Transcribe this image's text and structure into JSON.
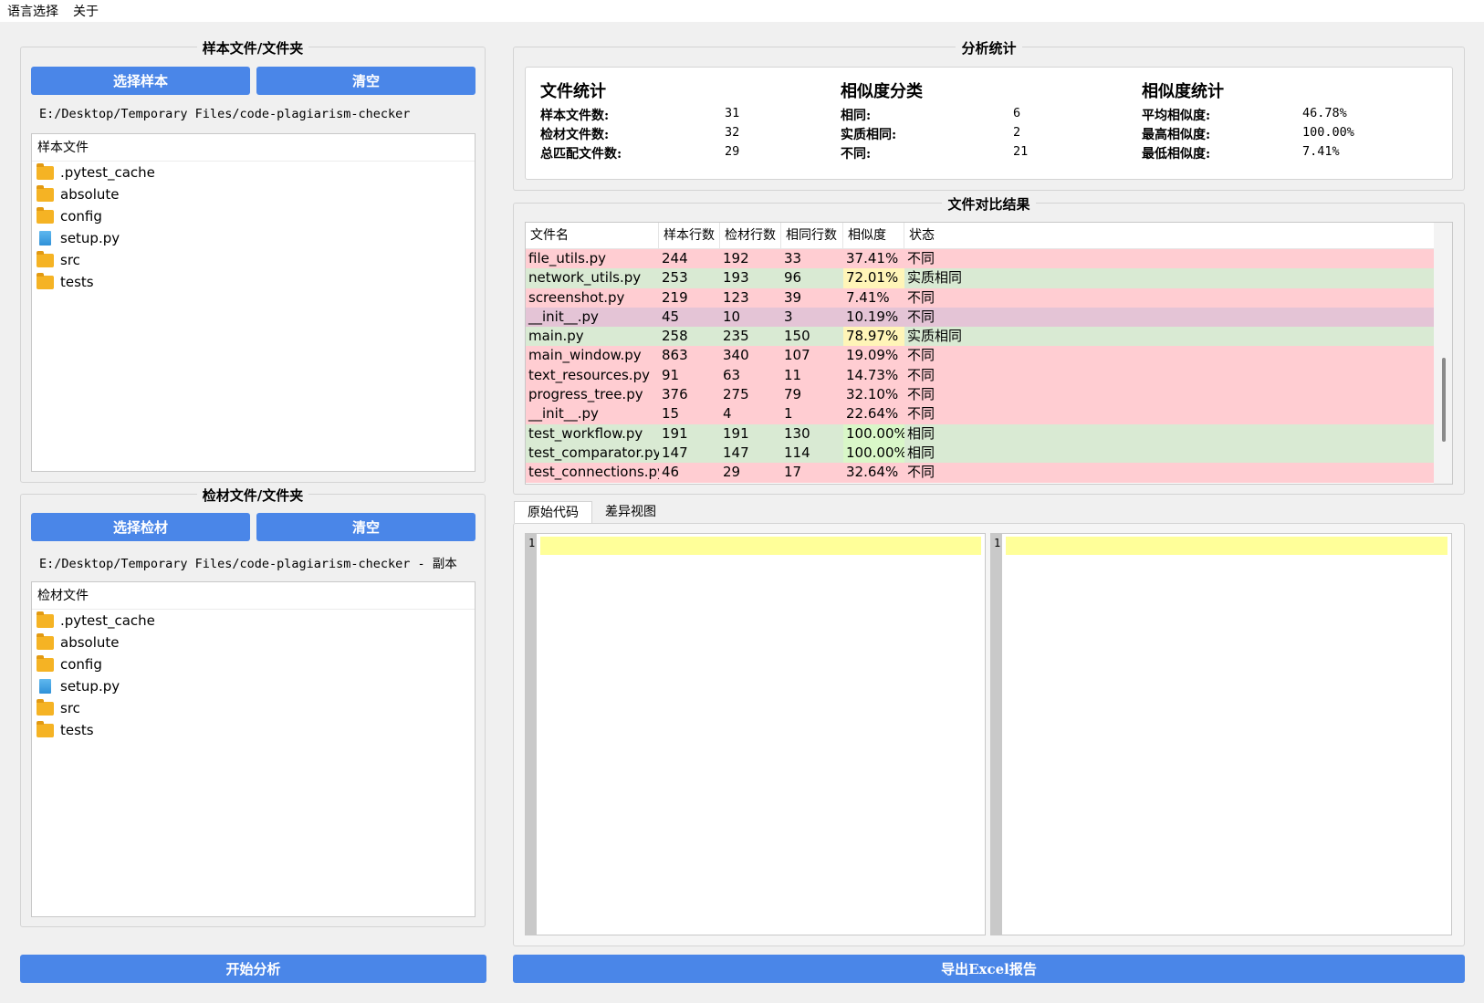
{
  "menu": {
    "language": "语言选择",
    "about": "关于"
  },
  "sample": {
    "group_title": "样本文件/文件夹",
    "select_label": "选择样本",
    "clear_label": "清空",
    "path": "E:/Desktop/Temporary Files/code-plagiarism-checker",
    "tree_header": "样本文件",
    "items": [
      {
        "name": ".pytest_cache",
        "icon": "folder-icon"
      },
      {
        "name": "absolute",
        "icon": "folder-icon"
      },
      {
        "name": "config",
        "icon": "folder-icon"
      },
      {
        "name": "setup.py",
        "icon": "file-icon"
      },
      {
        "name": "src",
        "icon": "folder-icon"
      },
      {
        "name": "tests",
        "icon": "folder-icon"
      }
    ]
  },
  "target": {
    "group_title": "检材文件/文件夹",
    "select_label": "选择检材",
    "clear_label": "清空",
    "path": "E:/Desktop/Temporary Files/code-plagiarism-checker - 副本",
    "tree_header": "检材文件",
    "items": [
      {
        "name": ".pytest_cache",
        "icon": "folder-icon"
      },
      {
        "name": "absolute",
        "icon": "folder-icon"
      },
      {
        "name": "config",
        "icon": "folder-icon"
      },
      {
        "name": "setup.py",
        "icon": "file-icon"
      },
      {
        "name": "src",
        "icon": "folder-icon"
      },
      {
        "name": "tests",
        "icon": "folder-icon"
      }
    ]
  },
  "stats": {
    "group_title": "分析统计",
    "file_stats": {
      "title": "文件统计",
      "rows": [
        {
          "label": "样本文件数:",
          "value": "31"
        },
        {
          "label": "检材文件数:",
          "value": "32"
        },
        {
          "label": "总匹配文件数:",
          "value": "29"
        }
      ]
    },
    "categories": {
      "title": "相似度分类",
      "rows": [
        {
          "label": "相同:",
          "value": "6"
        },
        {
          "label": "实质相同:",
          "value": "2"
        },
        {
          "label": "不同:",
          "value": "21"
        }
      ]
    },
    "similarity": {
      "title": "相似度统计",
      "rows": [
        {
          "label": "平均相似度:",
          "value": "46.78%"
        },
        {
          "label": "最高相似度:",
          "value": "100.00%"
        },
        {
          "label": "最低相似度:",
          "value": "7.41%"
        }
      ]
    }
  },
  "results": {
    "group_title": "文件对比结果",
    "columns": [
      "文件名",
      "样本行数",
      "检材行数",
      "相同行数",
      "相似度",
      "状态"
    ],
    "rows": [
      {
        "file": "file_utils.py",
        "sample": "244",
        "target": "192",
        "same": "33",
        "sim": "37.41%",
        "status": "不同",
        "bg": "#ffcdd2",
        "simbg": ""
      },
      {
        "file": "network_utils.py",
        "sample": "253",
        "target": "193",
        "same": "96",
        "sim": "72.01%",
        "status": "实质相同",
        "bg": "#d9ead3",
        "simbg": "#fff5b8"
      },
      {
        "file": "screenshot.py",
        "sample": "219",
        "target": "123",
        "same": "39",
        "sim": "7.41%",
        "status": "不同",
        "bg": "#ffcdd2",
        "simbg": ""
      },
      {
        "file": "__init__.py",
        "sample": "45",
        "target": "10",
        "same": "3",
        "sim": "10.19%",
        "status": "不同",
        "bg": "#e4c4d6",
        "simbg": ""
      },
      {
        "file": "main.py",
        "sample": "258",
        "target": "235",
        "same": "150",
        "sim": "78.97%",
        "status": "实质相同",
        "bg": "#d9ead3",
        "simbg": "#fff5b8"
      },
      {
        "file": "main_window.py",
        "sample": "863",
        "target": "340",
        "same": "107",
        "sim": "19.09%",
        "status": "不同",
        "bg": "#ffcdd2",
        "simbg": ""
      },
      {
        "file": "text_resources.py",
        "sample": "91",
        "target": "63",
        "same": "11",
        "sim": "14.73%",
        "status": "不同",
        "bg": "#ffcdd2",
        "simbg": ""
      },
      {
        "file": "progress_tree.py",
        "sample": "376",
        "target": "275",
        "same": "79",
        "sim": "32.10%",
        "status": "不同",
        "bg": "#ffcdd2",
        "simbg": ""
      },
      {
        "file": "__init__.py",
        "sample": "15",
        "target": "4",
        "same": "1",
        "sim": "22.64%",
        "status": "不同",
        "bg": "#ffcdd2",
        "simbg": ""
      },
      {
        "file": "test_workflow.py",
        "sample": "191",
        "target": "191",
        "same": "130",
        "sim": "100.00%",
        "status": "相同",
        "bg": "#d9ead3",
        "simbg": "#d9f7c8"
      },
      {
        "file": "test_comparator.py",
        "sample": "147",
        "target": "147",
        "same": "114",
        "sim": "100.00%",
        "status": "相同",
        "bg": "#d9ead3",
        "simbg": "#d9f7c8"
      },
      {
        "file": "test_connections.py",
        "sample": "46",
        "target": "29",
        "same": "17",
        "sim": "32.64%",
        "status": "不同",
        "bg": "#ffcdd2",
        "simbg": ""
      }
    ]
  },
  "viewer": {
    "tabs": [
      "原始代码",
      "差异视图"
    ],
    "left_line": "1",
    "right_line": "1"
  },
  "actions": {
    "start_label": "开始分析",
    "export_label": "导出Excel报告"
  },
  "colors": {
    "accent": "#4a86e8",
    "highlight": "#ffff99"
  }
}
